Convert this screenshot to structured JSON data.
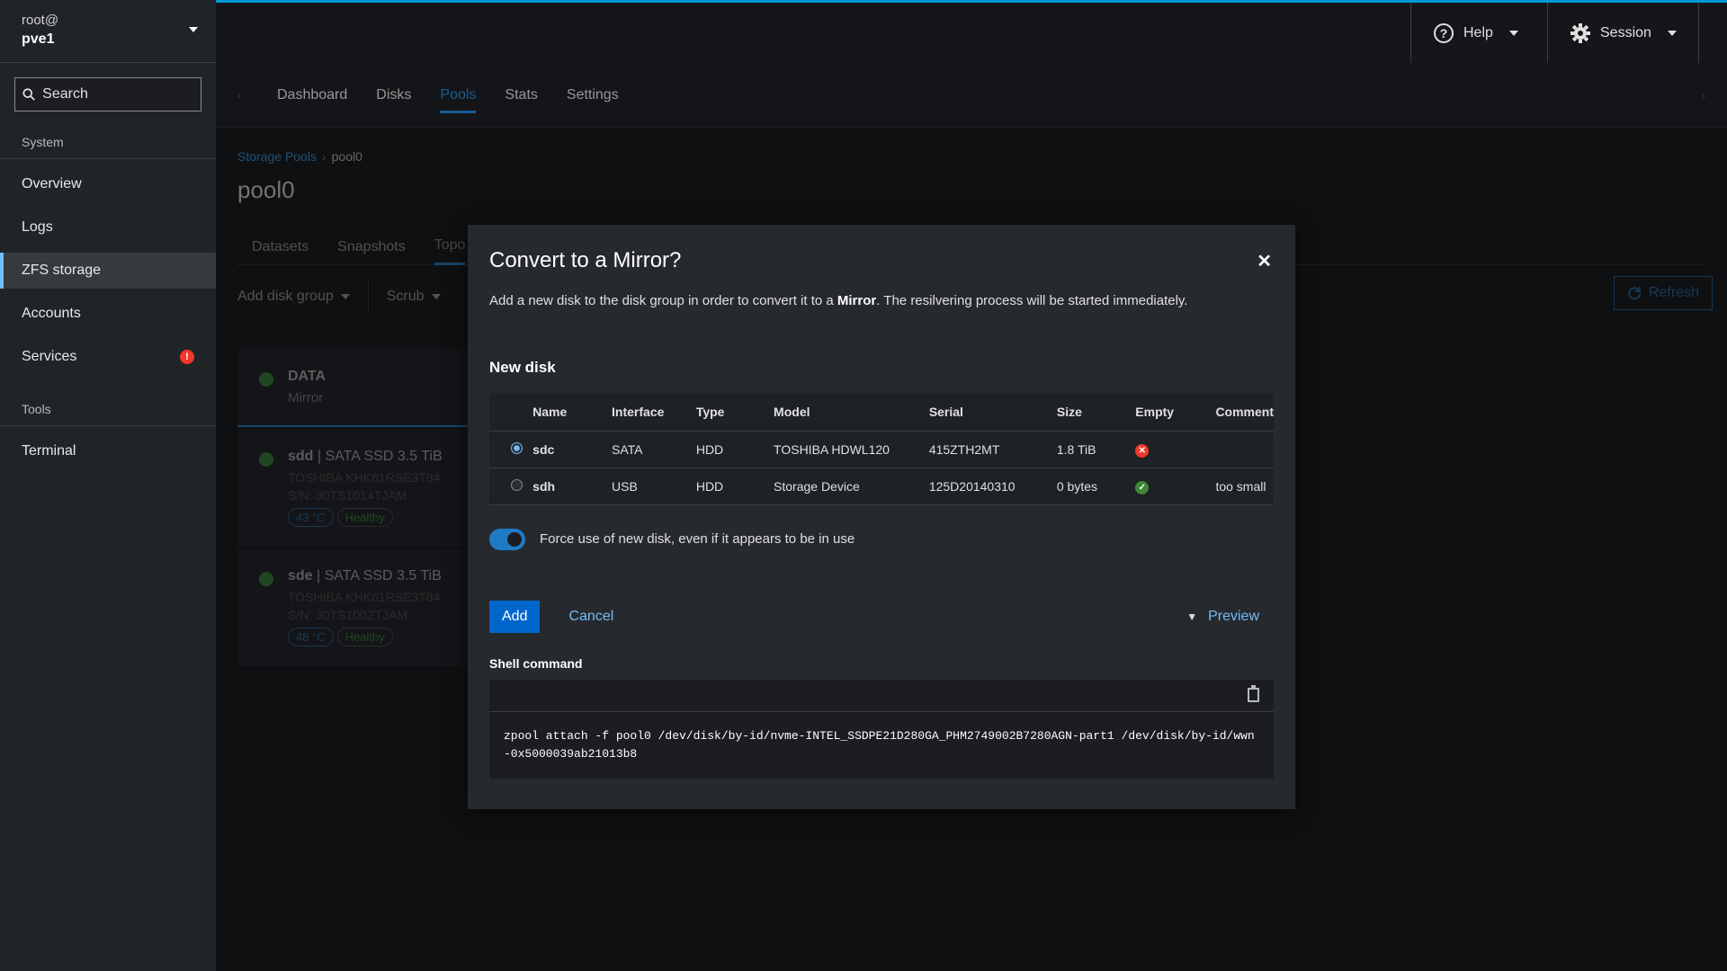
{
  "sidebar": {
    "user": "root@",
    "host": "pve1",
    "search_placeholder": "Search",
    "section_system": "System",
    "items": [
      {
        "label": "Overview"
      },
      {
        "label": "Logs"
      },
      {
        "label": "ZFS storage"
      },
      {
        "label": "Accounts"
      },
      {
        "label": "Services",
        "alert": "!"
      }
    ],
    "section_tools": "Tools",
    "tools": [
      {
        "label": "Terminal"
      }
    ]
  },
  "topbar": {
    "help": "Help",
    "session": "Session"
  },
  "tabs": [
    "Dashboard",
    "Disks",
    "Pools",
    "Stats",
    "Settings"
  ],
  "breadcrumb": {
    "parent": "Storage Pools",
    "current": "pool0"
  },
  "pool": {
    "title": "pool0",
    "subtabs": [
      "Datasets",
      "Snapshots",
      "Topo"
    ],
    "add_disk_group": "Add disk group",
    "scrub": "Scrub",
    "refresh": "Refresh",
    "cards": [
      {
        "name": "DATA",
        "sub": "Mirror"
      },
      {
        "name": "sdd",
        "desc": "| SATA SSD 3.5 TiB",
        "model": "TOSHIBA KHK61RSE3T84",
        "sn": "S/N: 30TS1014TJAM",
        "temp": "43 °C",
        "health": "Healthy"
      },
      {
        "name": "sde",
        "desc": "| SATA SSD 3.5 TiB",
        "model": "TOSHIBA KHK61RSE3T84",
        "sn": "S/N: 30TS100ZTJAM",
        "temp": "48 °C",
        "health": "Healthy"
      }
    ]
  },
  "modal": {
    "title": "Convert to a Mirror?",
    "desc_pre": "Add a new disk to the disk group in order to convert it to a ",
    "desc_bold": "Mirror",
    "desc_post": ". The resilvering process will be started immediately.",
    "new_disk": "New disk",
    "columns": [
      "Name",
      "Interface",
      "Type",
      "Model",
      "Serial",
      "Size",
      "Empty",
      "Comment"
    ],
    "rows": [
      {
        "name": "sdc",
        "interface": "SATA",
        "type": "HDD",
        "model": "TOSHIBA HDWL120",
        "serial": "415ZTH2MT",
        "size": "1.8 TiB",
        "empty": "no",
        "comment": "",
        "selected": true
      },
      {
        "name": "sdh",
        "interface": "USB",
        "type": "HDD",
        "model": "Storage Device",
        "serial": "125D20140310",
        "size": "0 bytes",
        "empty": "yes",
        "comment": "too small",
        "selected": false
      }
    ],
    "force_label": "Force use of new disk, even if it appears to be in use",
    "add": "Add",
    "cancel": "Cancel",
    "preview": "Preview",
    "shell_label": "Shell command",
    "command": "zpool attach -f pool0 /dev/disk/by-id/nvme-INTEL_SSDPE21D280GA_PHM2749002B7280AGN-part1 /dev/disk/by-id/wwn-0x5000039ab21013b8"
  }
}
